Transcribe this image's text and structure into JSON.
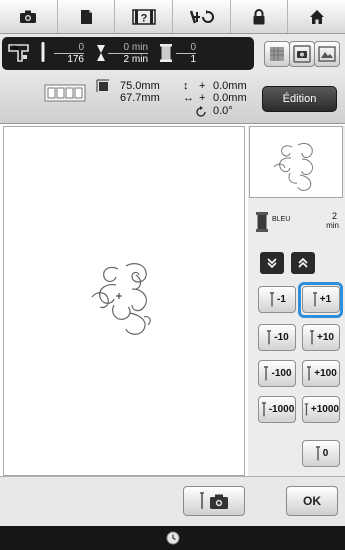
{
  "tabs": [
    {
      "name": "camera-tab-icon"
    },
    {
      "name": "page-tab-icon"
    },
    {
      "name": "help-tab-icon",
      "label": "?"
    },
    {
      "name": "thread-trim-tab-icon"
    },
    {
      "name": "lock-tab-icon"
    },
    {
      "name": "home-tab-icon"
    }
  ],
  "status": {
    "stitch_current": "0",
    "stitch_total": "176",
    "time_current": "0 min",
    "time_total": "2 min",
    "color_current": "0",
    "color_total": "1"
  },
  "measure": {
    "width": "75.0mm",
    "height": "67.7mm",
    "offset_v": "0.0mm",
    "offset_h": "0.0mm",
    "angle": "0.0°"
  },
  "edit_label": "Édition",
  "thread": {
    "color_name": "BLEU",
    "time_value": "2",
    "time_unit": "min"
  },
  "stitch_buttons": {
    "minus1": "-1",
    "plus1": "+1",
    "minus10": "-10",
    "plus10": "+10",
    "minus100": "-100",
    "plus100": "+100",
    "minus1000": "-1000",
    "plus1000": "+1000",
    "zero": "0"
  },
  "ok_label": "OK",
  "colors": {
    "highlight": "#2f8fd8",
    "thread_spool": "#3a3a3a"
  }
}
